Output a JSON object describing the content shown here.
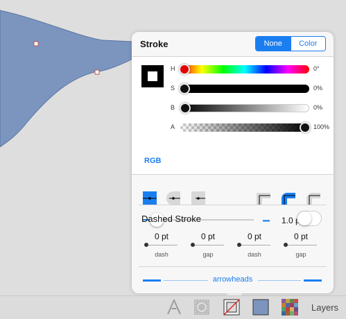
{
  "stroke_panel": {
    "title": "Stroke",
    "mode_options": [
      "None",
      "Color"
    ],
    "selected_mode": "None",
    "color": {
      "model_label": "RGB",
      "sliders": [
        {
          "label": "H",
          "value": "0°",
          "fraction": 0
        },
        {
          "label": "S",
          "value": "0%",
          "fraction": 0
        },
        {
          "label": "B",
          "value": "0%",
          "fraction": 0
        },
        {
          "label": "A",
          "value": "100%",
          "fraction": 1
        }
      ]
    },
    "width": {
      "value": "1.0 pt",
      "minus": "−",
      "plus": "+"
    },
    "dashed": {
      "label": "Dashed Stroke",
      "enabled": false,
      "fields": [
        {
          "value": "0 pt",
          "label": "dash"
        },
        {
          "value": "0 pt",
          "label": "gap"
        },
        {
          "value": "0 pt",
          "label": "dash"
        },
        {
          "value": "0 pt",
          "label": "gap"
        }
      ]
    },
    "arrowheads_label": "arrowheads"
  },
  "toolbar": {
    "layers_label": "Layers"
  },
  "colors": {
    "accent": "#1a7ef0",
    "shape_fill": "#7b95bf"
  }
}
